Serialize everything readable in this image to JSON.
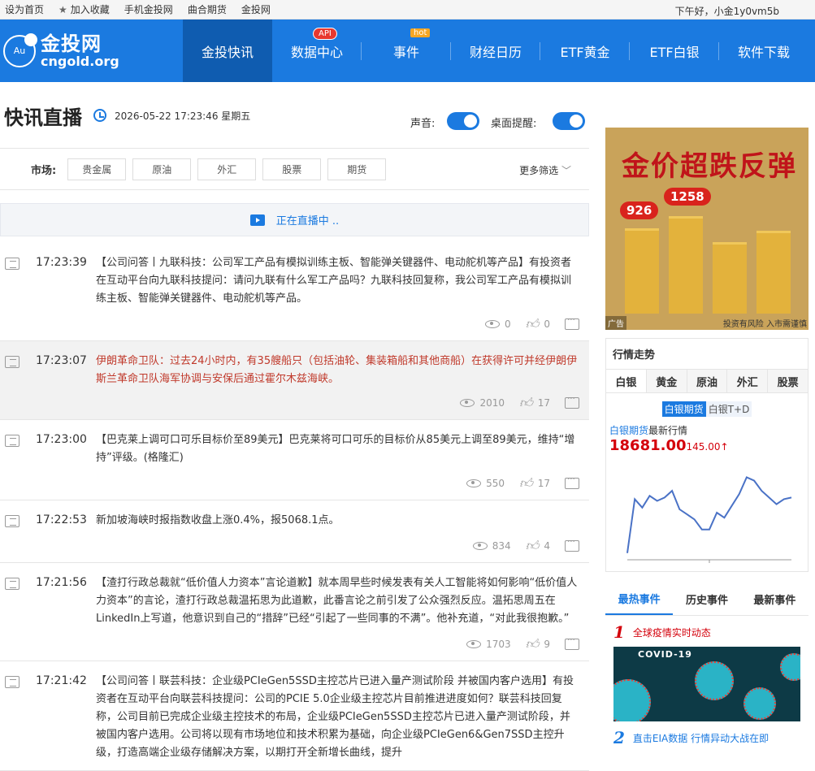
{
  "topbar": {
    "links": [
      "设为首页",
      "加入收藏",
      "手机金投网",
      "曲合期货",
      "金投网"
    ],
    "greeting": "下午好，小金1y0vm5b"
  },
  "logo": {
    "symbol": "Au",
    "cn": "金投网",
    "en": "cngold.org"
  },
  "nav": {
    "items": [
      "金投快讯",
      "数据中心",
      "事件",
      "财经日历",
      "ETF黄金",
      "ETF白银",
      "软件下载"
    ],
    "badge_api": "API",
    "badge_hot": "hot"
  },
  "header": {
    "title": "快讯直播",
    "datetime": "2026-05-22 17:23:46 星期五",
    "sound_label": "声音:",
    "desktop_label": "桌面提醒:"
  },
  "filter": {
    "label": "市场:",
    "tags": [
      "贵金属",
      "原油",
      "外汇",
      "股票",
      "期货"
    ],
    "more": "更多筛选"
  },
  "live": {
    "text": "正在直播中 .."
  },
  "news": [
    {
      "time": "17:23:39",
      "text": "【公司问答丨九联科技：公司军工产品有模拟训练主板、智能弹关键器件、电动舵机等产品】有投资者在互动平台向九联科技提问：请问九联有什么军工产品吗？九联科技回复称，我公司军工产品有模拟训练主板、智能弹关键器件、电动舵机等产品。",
      "views": "0",
      "likes": "0"
    },
    {
      "time": "17:23:07",
      "text": "伊朗革命卫队：过去24小时内，有35艘船只（包括油轮、集装箱船和其他商船）在获得许可并经伊朗伊斯兰革命卫队海军协调与安保后通过霍尔木兹海峡。",
      "views": "2010",
      "likes": "17"
    },
    {
      "time": "17:23:00",
      "text": "【巴克莱上调可口可乐目标价至89美元】巴克莱将可口可乐的目标价从85美元上调至89美元，维持“增持”评级。(格隆汇)",
      "views": "550",
      "likes": "17"
    },
    {
      "time": "17:22:53",
      "text": "新加坡海峡时报指数收盘上涨0.4%，报5068.1点。",
      "views": "834",
      "likes": "4"
    },
    {
      "time": "17:21:56",
      "text": "【渣打行政总裁就“低价值人力资本”言论道歉】就本周早些时候发表有关人工智能将如何影响“低价值人力资本”的言论，渣打行政总裁温拓思为此道歉，此番言论之前引发了公众强烈反应。温拓思周五在LinkedIn上写道，他意识到自己的“措辞”已经“引起了一些同事的不满”。他补充道，“对此我很抱歉。”",
      "views": "1703",
      "likes": "9"
    },
    {
      "time": "17:21:42",
      "text": "【公司问答丨联芸科技：企业级PCIeGen5SSD主控芯片已进入量产测试阶段 并被国内客户选用】有投资者在互动平台向联芸科技提问：公司的PCIE 5.0企业级主控芯片目前推进进度如何？联芸科技回复称，公司目前已完成企业级主控技术的布局，企业级PCIeGen5SSD主控芯片已进入量产测试阶段，并被国内客户选用。公司将以现有市场地位和技术积累为基础，向企业级PCIeGen6&Gen7SSD主控升级，打造高端企业级存储解决方案，以期打开全新增长曲线，提升",
      "views": "",
      "likes": ""
    }
  ],
  "ad": {
    "title": "金价超跌反弹",
    "bubble1": "926",
    "bubble2": "1258",
    "tag": "广告",
    "risk": "投资有风险 入市需谨慎"
  },
  "market": {
    "title": "行情走势",
    "tabs": [
      "白银",
      "黄金",
      "原油",
      "外汇",
      "股票"
    ],
    "subtabs": [
      "白银期货",
      "白银T+D"
    ],
    "quote_name": "白银期货",
    "quote_label": "最新行情",
    "price": "18681.00",
    "change": "145.00↑"
  },
  "chart_data": {
    "type": "line",
    "title": "",
    "xlabel": "",
    "ylabel": "",
    "series": [
      {
        "values": [
          120,
          280,
          255,
          290,
          275,
          285,
          305,
          250,
          235,
          220,
          190,
          190,
          240,
          225,
          260,
          295,
          345,
          335,
          305,
          285,
          265,
          280,
          285
        ]
      }
    ],
    "ylim": [
      100,
      380
    ]
  },
  "events": {
    "tabs": [
      "最热事件",
      "历史事件",
      "最新事件"
    ],
    "items": [
      {
        "num": "1",
        "title": "全球疫情实时动态",
        "image_text": "COVID-19"
      },
      {
        "num": "2",
        "title": "直击EIA数据 行情异动大战在即"
      }
    ]
  }
}
